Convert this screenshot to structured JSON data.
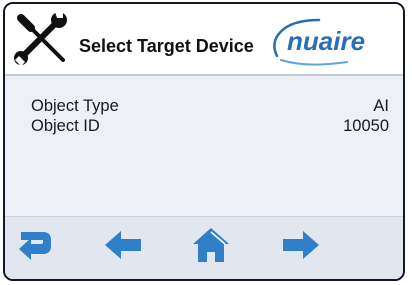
{
  "header": {
    "title": "Select Target Device",
    "logo_text": "nuaire",
    "tools_icon": "wrench-screwdriver-icon"
  },
  "fields": [
    {
      "label": "Object Type",
      "value": "AI"
    },
    {
      "label": "Object ID",
      "value": "10050"
    }
  ],
  "nav": {
    "buttons": [
      {
        "icon": "return-arrow-icon"
      },
      {
        "icon": "arrow-left-icon"
      },
      {
        "icon": "home-icon"
      },
      {
        "icon": "arrow-right-icon"
      }
    ]
  },
  "colors": {
    "nav_icon": "#2f80c8",
    "logo_text": "#2a6fb3",
    "content_bg": "#edf0f7",
    "nav_bg": "#e2e6ef",
    "frame": "#121a2a"
  }
}
